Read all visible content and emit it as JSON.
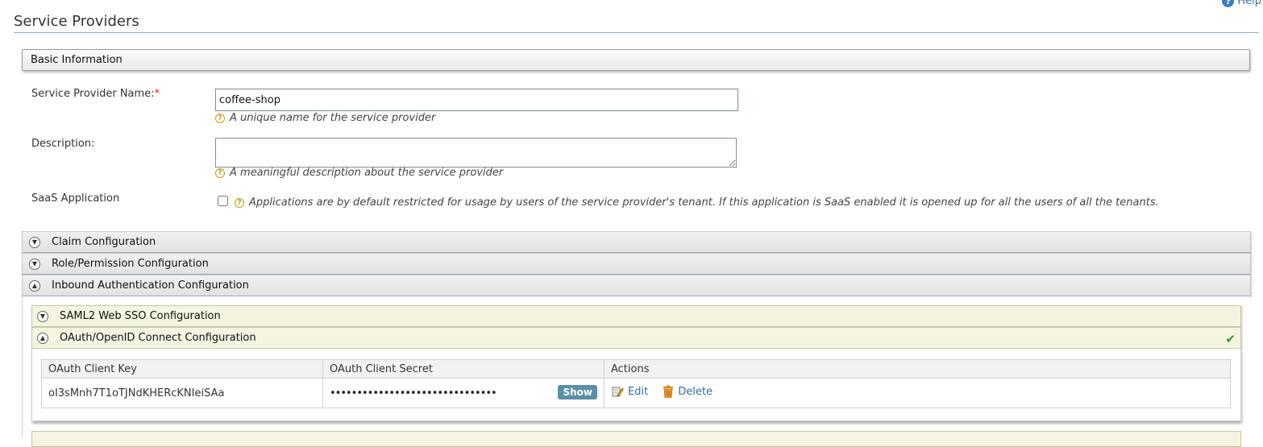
{
  "header": {
    "help_label": "Help",
    "page_title": "Service Providers"
  },
  "basic_info": {
    "section_title": "Basic Information",
    "name_label": "Service Provider Name:",
    "required_mark": "*",
    "name_value": "coffee-shop",
    "name_hint": "A unique name for the service provider",
    "description_label": "Description:",
    "description_value": "",
    "description_hint": "A meaningful description about the service provider",
    "saas_label": "SaaS Application",
    "saas_checked": false,
    "saas_hint": "Applications are by default restricted for usage by users of the service provider's tenant. If this application is SaaS enabled it is opened up for all the users of all the tenants."
  },
  "sections": {
    "claim": "Claim Configuration",
    "role": "Role/Permission Configuration",
    "inbound": "Inbound Authentication Configuration"
  },
  "inbound": {
    "saml": "SAML2 Web SSO Configuration",
    "oauth": "OAuth/OpenID Connect Configuration",
    "oauth_configured": true
  },
  "oauth_table": {
    "headers": [
      "OAuth Client Key",
      "OAuth Client Secret",
      "Actions"
    ],
    "client_key": "oI3sMnh7T1oTJNdKHERcKNIeiSAa",
    "client_secret_masked": "•••••••••••••••••••••••••••••••",
    "show_label": "Show",
    "edit_label": "Edit",
    "delete_label": "Delete"
  },
  "colors": {
    "link": "#2f6fa7",
    "check": "#2a9a2a",
    "show_button": "#5b8fa8"
  }
}
